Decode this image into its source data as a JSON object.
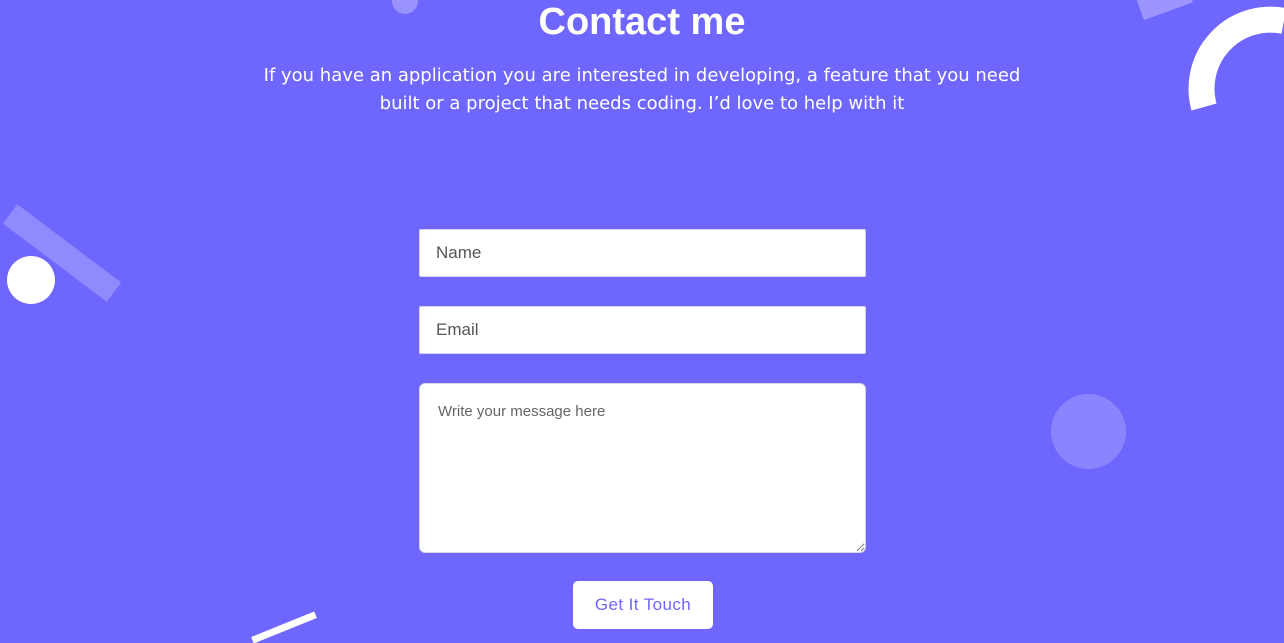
{
  "contact": {
    "title": "Contact me",
    "subtitle": "If you have an application you are interested in developing, a feature that you need built or a project that needs coding. I’d love to help with it"
  },
  "form": {
    "name_placeholder": "Name",
    "email_placeholder": "Email",
    "message_placeholder": "Write your message here",
    "submit_label": "Get It Touch"
  },
  "colors": {
    "background": "#6f66fd",
    "accent": "#6f66fd",
    "field_background": "#ffffff",
    "text_light": "#ffffff"
  },
  "decorations": [
    "circle-shape",
    "ring-arc-shape",
    "bar-shape"
  ]
}
